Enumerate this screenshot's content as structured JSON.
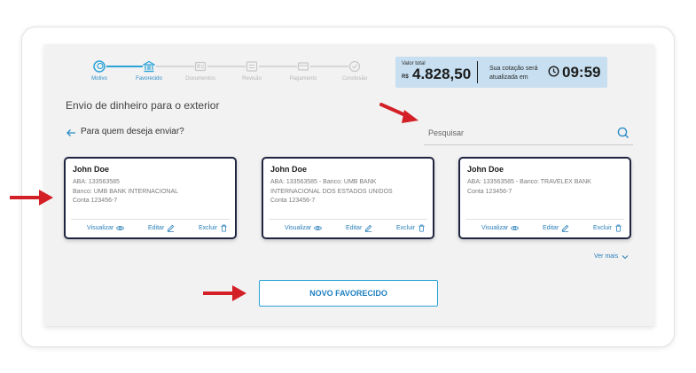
{
  "stepper": {
    "steps": [
      {
        "label": "Motivo",
        "icon": "coin-icon",
        "state": "active"
      },
      {
        "label": "Favorecido",
        "icon": "bank-icon",
        "state": "active"
      },
      {
        "label": "Documentos",
        "icon": "id-card-icon",
        "state": "inactive"
      },
      {
        "label": "Revisão",
        "icon": "list-icon",
        "state": "inactive"
      },
      {
        "label": "Pagamento",
        "icon": "payment-icon",
        "state": "inactive"
      },
      {
        "label": "Conclusão",
        "icon": "check-icon",
        "state": "inactive"
      }
    ],
    "active_color": "#2aa3d8",
    "inactive_color": "#c8c8c8"
  },
  "valor": {
    "label": "Valor total",
    "currency": "R$",
    "amount": "4.828,50",
    "cotacao": "Sua cotação será atualizada em",
    "timer": "09:59",
    "background": "#c7dff0"
  },
  "page": {
    "heading": "Envio de dinheiro para o exterior",
    "question": "Para quem deseja enviar?"
  },
  "search": {
    "placeholder": "Pesquisar"
  },
  "cards": [
    {
      "name": "John Doe",
      "line1": "ABA: 133563585",
      "line2": "Banco: UMB BANK INTERNACIONAL",
      "line3": "Conta 123456-7"
    },
    {
      "name": "John Doe",
      "line1": "ABA: 133563585 - Banco: UMB BANK",
      "line2": "INTERNACIONAL DOS ESTADOS UNIDOS",
      "line3": "Conta 123456-7"
    },
    {
      "name": "John Doe",
      "line1": "ABA: 133563585 - Banco: TRAVELEX BANK",
      "line2": "Conta 123456-7",
      "line3": ""
    }
  ],
  "card_actions": {
    "view": "Visualizar",
    "edit": "Editar",
    "delete": "Excluir"
  },
  "ver_mais": "Ver mais",
  "novo_button": "NOVO FAVORECIDO",
  "colors": {
    "accent": "#2aa3d8",
    "link": "#2a7fb8",
    "card_border": "#1f2540",
    "annotation_arrow": "#d32027"
  }
}
